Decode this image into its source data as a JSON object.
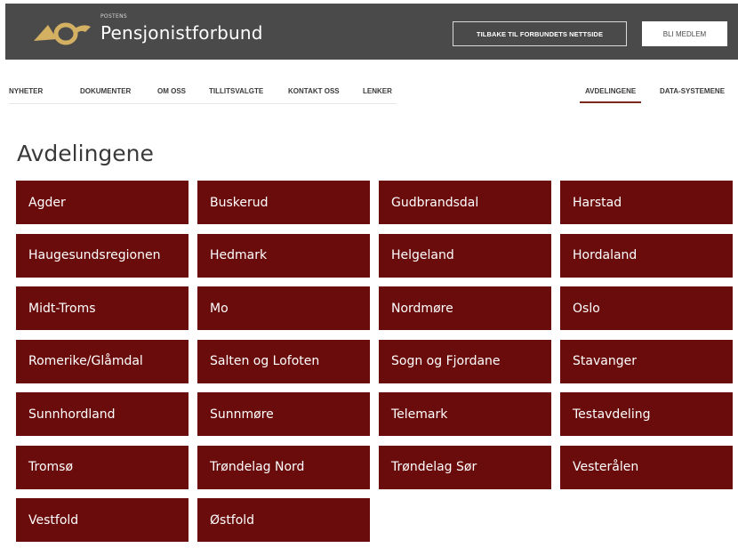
{
  "header": {
    "brand_small": "POSTENS",
    "brand": "Pensjonistforbund",
    "back_button": "TILBAKE TIL FORBUNDETS NETTSIDE",
    "join_button": "BLI MEDLEM",
    "logo_color": "#d4b063",
    "bar_color": "#4a4a4a"
  },
  "nav": {
    "left": [
      "NYHETER",
      "DOKUMENTER",
      "OM OSS",
      "TILLITSVALGTE",
      "KONTAKT OSS",
      "LENKER"
    ],
    "right": [
      "AVDELINGENE",
      "DATA-SYSTEMENE"
    ],
    "active": "AVDELINGENE",
    "active_color": "#7a2a1a"
  },
  "page": {
    "title": "Avdelingene",
    "tile_color": "#6b0c0c"
  },
  "departments": [
    "Agder",
    "Buskerud",
    "Gudbrandsdal",
    "Harstad",
    "Haugesundsregionen",
    "Hedmark",
    "Helgeland",
    "Hordaland",
    "Midt-Troms",
    "Mo",
    "Nordmøre",
    "Oslo",
    "Romerike/Glåmdal",
    "Salten og Lofoten",
    "Sogn og Fjordane",
    "Stavanger",
    "Sunnhordland",
    "Sunnmøre",
    "Telemark",
    "Testavdeling",
    "Tromsø",
    "Trøndelag Nord",
    "Trøndelag Sør",
    "Vesterålen",
    "Vestfold",
    "Østfold"
  ]
}
